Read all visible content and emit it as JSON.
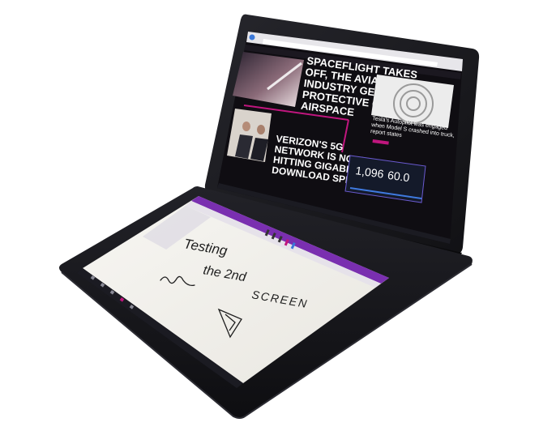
{
  "photo": {
    "colors": {
      "background": "#ffffff",
      "chassis": "#18181c",
      "chassis_edge": "#2c2c33",
      "web_bg": "#0f0d12",
      "accent_magenta": "#c0167e",
      "accent_purple": "#7a2fb0",
      "paper": "#f3f1ec",
      "ink": "#1e1e1e",
      "taskbar": "#1b1b22"
    },
    "top_screen": {
      "headlines": {
        "spaceflight": [
          "SPACEFLIGHT TAKES",
          "OFF, THE AVIATION",
          "INDUSTRY GETS",
          "PROTECTIVE OF",
          "AIRSPACE"
        ],
        "verizon": [
          "VERIZON'S 5G",
          "NETWORK IS NOW",
          "HITTING GIGABIT",
          "DOWNLOAD SPEEDS"
        ],
        "tesla": [
          "Tesla's Autopilot was engaged",
          "when Model S crashed into truck,",
          "report states"
        ]
      },
      "speedtest": {
        "download": "1,096",
        "upload": "60.0"
      }
    },
    "bottom_screen": {
      "handwriting": [
        "Testing",
        "the 2nd",
        "SCREEN"
      ]
    }
  }
}
